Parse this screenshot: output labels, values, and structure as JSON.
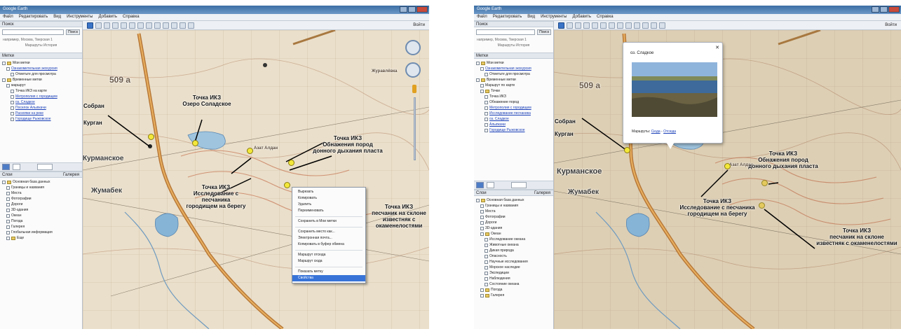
{
  "left": {
    "title": "Google Earth",
    "menu": [
      "Файл",
      "Редактировать",
      "Вид",
      "Инструменты",
      "Добавить",
      "Справка"
    ],
    "signin": "Войти",
    "search_panel": "Поиск",
    "search_button": "Поиск",
    "search_hint": "например, Москва, Тверская 1",
    "search_links": "Маршруты    История",
    "places_panel": "Метки",
    "places_items": [
      {
        "text": "Мои метки",
        "type": "folder",
        "level": 0
      },
      {
        "text": "Ознакомительная экскурсия",
        "type": "link",
        "level": 1
      },
      {
        "text": "Отметьте для просмотра",
        "type": "plain",
        "level": 2
      },
      {
        "text": "Временные метки",
        "type": "folder",
        "level": 0
      },
      {
        "text": "маршрут",
        "type": "plain",
        "level": 1
      },
      {
        "text": "Точка ИКЗ на карте",
        "type": "plain",
        "level": 2
      },
      {
        "text": "Метрополия с городищем",
        "type": "link",
        "level": 2
      },
      {
        "text": "оз. Сладкое",
        "type": "link",
        "level": 2
      },
      {
        "text": "Поселок Алыпкачи",
        "type": "link",
        "level": 2
      },
      {
        "text": "Раскопки на реке",
        "type": "link",
        "level": 2
      },
      {
        "text": "Городище Рыжовское",
        "type": "link",
        "level": 2
      }
    ],
    "layers_panel": "Слои",
    "layers_label": "Галерея",
    "layers_items": [
      {
        "text": "Основная база данных",
        "type": "folder",
        "level": 0
      },
      {
        "text": "Границы и названия",
        "type": "plain",
        "level": 1
      },
      {
        "text": "Места",
        "type": "plain",
        "level": 1
      },
      {
        "text": "Фотографии",
        "type": "plain",
        "level": 1
      },
      {
        "text": "Дороги",
        "type": "plain",
        "level": 1
      },
      {
        "text": "3D-здания",
        "type": "plain",
        "level": 1
      },
      {
        "text": "Океан",
        "type": "plain",
        "level": 1
      },
      {
        "text": "Погода",
        "type": "plain",
        "level": 1
      },
      {
        "text": "Галерея",
        "type": "plain",
        "level": 1
      },
      {
        "text": "Глобальная информация",
        "type": "plain",
        "level": 1
      },
      {
        "text": "Еще",
        "type": "folder",
        "level": 1
      }
    ],
    "map_labels": {
      "l509": "509 а",
      "l_sobar": "Собран",
      "l_kurgan": "Курган",
      "l_kurm": "Курманское",
      "l_zhuravl": "Журавлёвка",
      "l_zh": "Жумабек",
      "l_azat": "Азат Алдан",
      "l_point1": "Точка ИКЗ\nОзеро Соладское",
      "l_point2": "Точка ИКЗ\nОбнажения пород\nдонного дыхания пласта",
      "l_point3": "Точка ИКЗ\nИсследование с песчаника\nгородищем на берегу",
      "l_point4": "Точка ИКЗ\nпесчаник на склоне\nизвестняк с окаменелостями"
    },
    "context_menu": [
      "Вырезать",
      "Копировать",
      "Удалить",
      "Переименовать",
      "",
      "Сохранить в Мои метки",
      "",
      "Сохранить место как...",
      "Электронная почта...",
      "Копировать в буфер обмена",
      "",
      "Маршрут отсюда",
      "Маршрут сюда",
      "",
      "Показать метку",
      "Свойства"
    ]
  },
  "right": {
    "title": "Google Earth",
    "signin": "Войти",
    "search_panel": "Поиск",
    "search_button": "Поиск",
    "search_hint": "например, Москва, Тверская 1",
    "search_links": "Маршруты    История",
    "places_panel": "Метки",
    "places_items": [
      {
        "text": "Мои метки",
        "type": "folder",
        "level": 0
      },
      {
        "text": "Ознакомительная экскурсия",
        "type": "link",
        "level": 1
      },
      {
        "text": "Отметьте для просмотра",
        "type": "plain",
        "level": 2
      },
      {
        "text": "Временные метки",
        "type": "folder",
        "level": 0
      },
      {
        "text": "Маршрут по карте",
        "type": "plain",
        "level": 1
      },
      {
        "text": "Точки",
        "type": "folder",
        "level": 1
      },
      {
        "text": "Точка ИКЗ",
        "type": "plain",
        "level": 2
      },
      {
        "text": "Обнажение пород",
        "type": "plain",
        "level": 2
      },
      {
        "text": "Метрополия с городищем",
        "type": "link",
        "level": 2
      },
      {
        "text": "Исследование песчаника",
        "type": "link",
        "level": 2
      },
      {
        "text": "оз. Сладкое",
        "type": "link",
        "level": 2
      },
      {
        "text": "Алыпкачи",
        "type": "link",
        "level": 2
      },
      {
        "text": "Городище Рыжовское",
        "type": "link",
        "level": 2
      }
    ],
    "layers_panel": "Слои",
    "layers_label": "Галерея",
    "layers_items": [
      {
        "text": "Основная база данных",
        "type": "folder",
        "level": 0
      },
      {
        "text": "Границы и названия",
        "type": "plain",
        "level": 1
      },
      {
        "text": "Места",
        "type": "plain",
        "level": 1
      },
      {
        "text": "Фотографии",
        "type": "plain",
        "level": 1
      },
      {
        "text": "Дороги",
        "type": "plain",
        "level": 1
      },
      {
        "text": "3D-здания",
        "type": "plain",
        "level": 1
      },
      {
        "text": "Океан",
        "type": "folder",
        "level": 1
      },
      {
        "text": "Исследование океана",
        "type": "plain",
        "level": 2
      },
      {
        "text": "Животные океана",
        "type": "plain",
        "level": 2
      },
      {
        "text": "Дикая природа",
        "type": "plain",
        "level": 2
      },
      {
        "text": "Опасность",
        "type": "plain",
        "level": 2
      },
      {
        "text": "Научные исследования",
        "type": "plain",
        "level": 2
      },
      {
        "text": "Морское наследие",
        "type": "plain",
        "level": 2
      },
      {
        "text": "Экспедиции",
        "type": "plain",
        "level": 2
      },
      {
        "text": "Наблюдения",
        "type": "plain",
        "level": 2
      },
      {
        "text": "Состояние океана",
        "type": "plain",
        "level": 2
      },
      {
        "text": "Погода",
        "type": "folder",
        "level": 1
      },
      {
        "text": "Галерея",
        "type": "folder",
        "level": 1
      }
    ],
    "balloon": {
      "title": "оз. Сладкое",
      "footer_prefix": "Маршруты: ",
      "link_to": "Сюда",
      "link_from": "Отсюда",
      "close": "✕"
    },
    "map_labels": {
      "r509": "509 а",
      "r_sobar": "Собран",
      "r_kurgan": "Курган",
      "r_kurm": "Курманское",
      "r_zh": "Жумабек",
      "r_azat": "Азат Алдан",
      "r_point1": "Точка ИКЗ\nОбнажения пород\nдонного дыхания пласта",
      "r_point2": "Точка ИКЗ\nИсследование с песчаника\nгородищем на берегу",
      "r_point3": "Точка ИКЗ\nпесчаник на склоне\nизвестняк с окаменелостями"
    }
  }
}
